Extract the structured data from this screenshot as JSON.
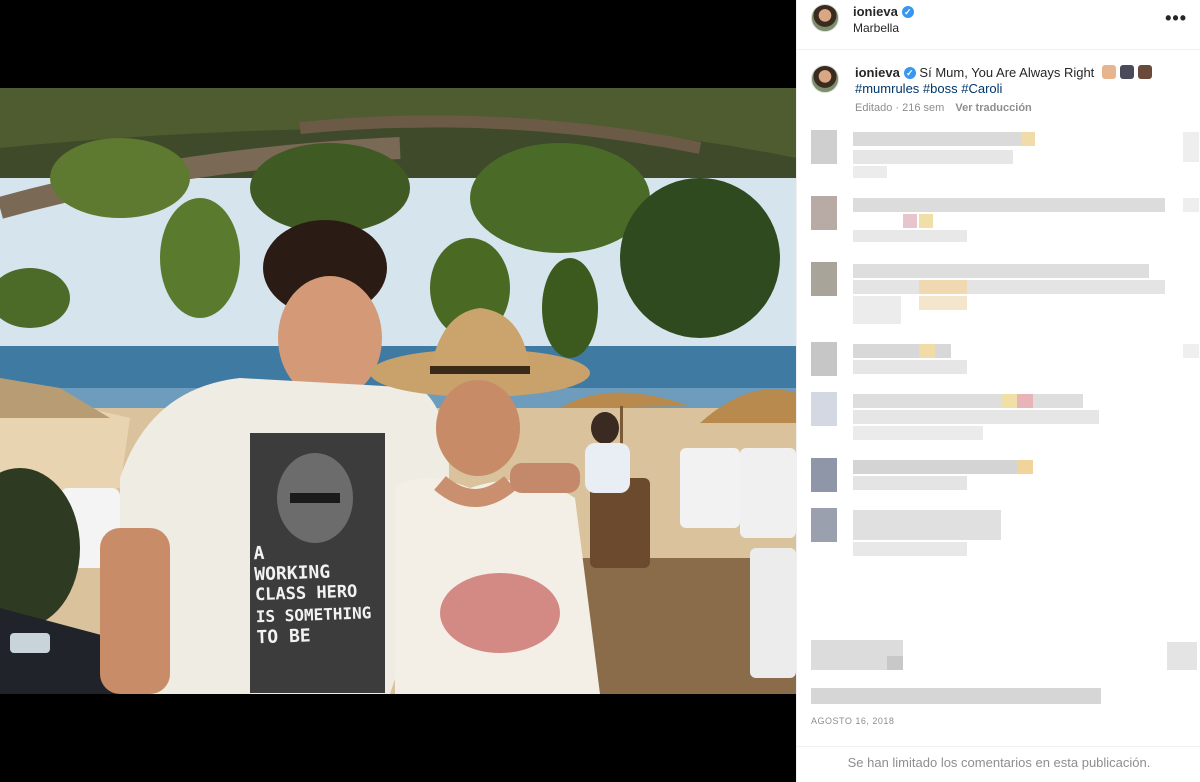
{
  "post": {
    "username": "ionieva",
    "verified_glyph": "✓",
    "location": "Marbella",
    "more_glyph": "•••",
    "caption_text": "Sí Mum, You Are Always Right",
    "caption_emojis": [
      "pointing-finger-emoji",
      "police-officer-emoji",
      "woman-emoji"
    ],
    "hashtags": [
      "#mumrules",
      "#boss",
      "#Caroli"
    ],
    "edited_label": "Editado · 216 sem",
    "translate_label": "Ver traducción",
    "date": "AGOSTO 16, 2018",
    "comments_limited": "Se han limitado los comentarios en esta publicación."
  },
  "photo": {
    "shirt_text": [
      "A",
      "WORKING",
      "CLASS HERO",
      "IS SOMETHING",
      "TO BE"
    ]
  }
}
